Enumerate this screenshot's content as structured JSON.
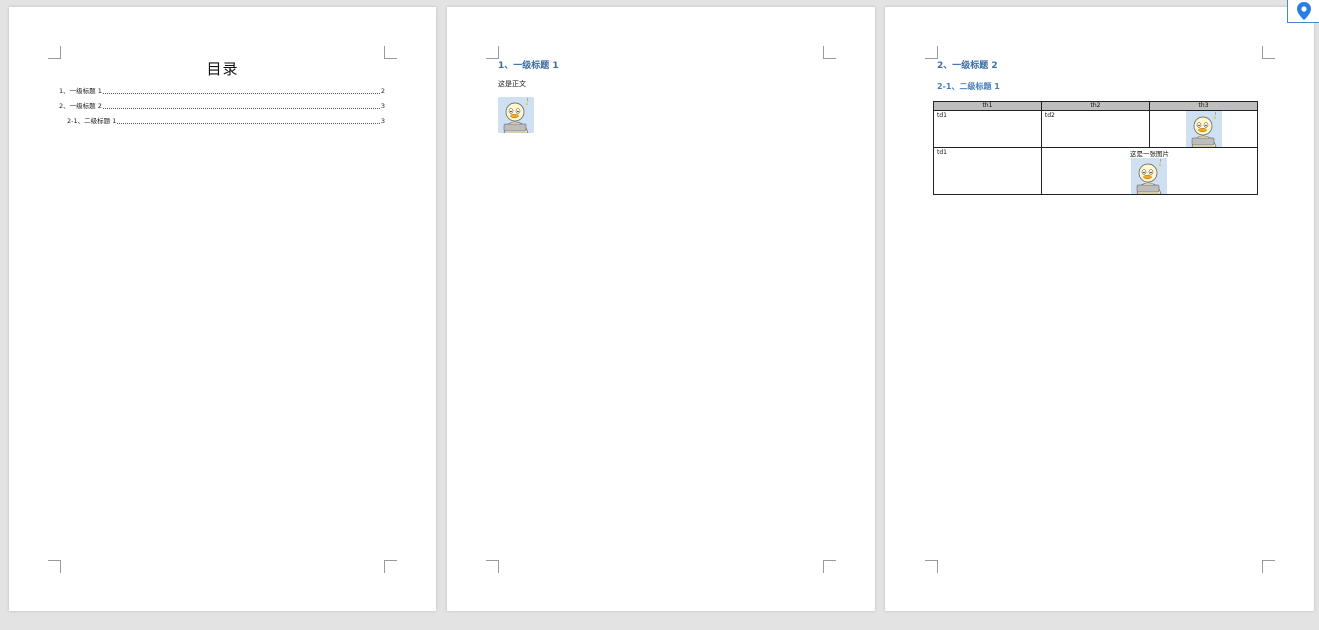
{
  "toc": {
    "title": "目录",
    "entries": [
      {
        "label": "1、一级标题 1",
        "page": "2"
      },
      {
        "label": "2、一级标题 2",
        "page": "3"
      },
      {
        "label": "2-1、二级标题 1",
        "page": "3"
      }
    ]
  },
  "page2": {
    "heading": "1、一级标题 1",
    "body": "这是正文",
    "image_icon": "cartoon-duck-sticker"
  },
  "page3": {
    "heading": "2、一级标题 2",
    "subheading": "2-1、二级标题 1",
    "table": {
      "headers": [
        "th1",
        "th2",
        "th3"
      ],
      "row1": {
        "c1": "td1",
        "c2": "td2",
        "c3_icon": "cartoon-duck-sticker"
      },
      "row2": {
        "c1": "td1",
        "merged_caption": "这是一张图片",
        "merged_icon": "cartoon-duck-sticker"
      }
    }
  },
  "overlay": {
    "icon": "location-pin-icon",
    "color": "#2a7de1"
  },
  "colors": {
    "heading": "#3a6ea5",
    "table_header_bg": "#bfbfbf",
    "page_bg": "#ffffff",
    "canvas_bg": "#e3e3e3"
  }
}
